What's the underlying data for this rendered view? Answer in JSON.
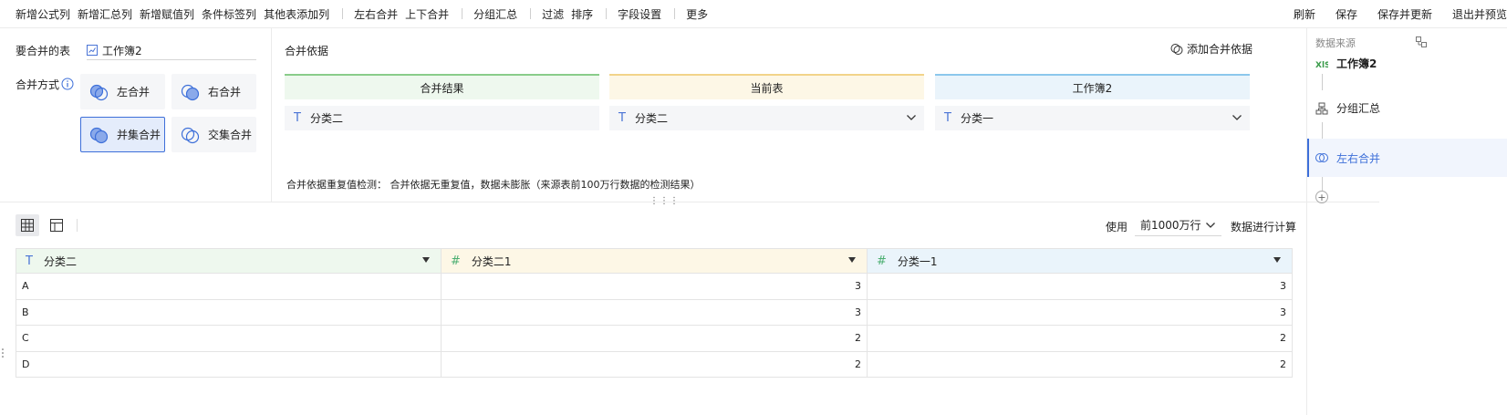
{
  "toolbar": {
    "left_groups": [
      [
        "新增公式列",
        "新增汇总列",
        "新增赋值列",
        "条件标签列",
        "其他表添加列"
      ],
      [
        "左右合并",
        "上下合并"
      ],
      [
        "分组汇总"
      ],
      [
        "过滤",
        "排序"
      ],
      [
        "字段设置"
      ],
      [
        "更多"
      ]
    ],
    "right": [
      "刷新",
      "保存",
      "保存并更新",
      "退出并预览"
    ]
  },
  "merge_config": {
    "table_label": "要合并的表",
    "table_value": "工作簿2",
    "mode_label": "合并方式",
    "modes": [
      "左合并",
      "右合并",
      "并集合并",
      "交集合并"
    ],
    "active_mode": 2,
    "basis_title": "合并依据",
    "add_basis": "添加合并依据",
    "columns": {
      "result": {
        "header": "合并结果",
        "field": "分类二"
      },
      "current": {
        "header": "当前表",
        "field": "分类二"
      },
      "other": {
        "header": "工作簿2",
        "field": "分类一"
      }
    },
    "dup_check": "合并依据重复值检测：   合并依据无重复值，数据未膨胀（来源表前100万行数据的检测结果）"
  },
  "preview": {
    "use_label": "使用",
    "row_option": "前1000万行",
    "calc_label": "数据进行计算",
    "columns": [
      {
        "name": "分类二",
        "type": "T"
      },
      {
        "name": "分类二1",
        "type": "#"
      },
      {
        "name": "分类一1",
        "type": "#"
      }
    ],
    "rows": [
      [
        "A",
        "3",
        "3"
      ],
      [
        "B",
        "3",
        "3"
      ],
      [
        "C",
        "2",
        "2"
      ],
      [
        "D",
        "2",
        "2"
      ]
    ]
  },
  "side_panel": {
    "title": "数据来源",
    "nodes": [
      {
        "label": "工作簿2",
        "icon": "xls-icon"
      },
      {
        "label": "分组汇总",
        "icon": "group-icon"
      },
      {
        "label": "左右合并",
        "icon": "merge-icon"
      }
    ],
    "active_node": 2
  },
  "colors": {
    "accent": "#3d6fd9",
    "green_header": "#eef8ee",
    "yellow_header": "#fdf7e6",
    "blue_header": "#eaf4fb"
  }
}
